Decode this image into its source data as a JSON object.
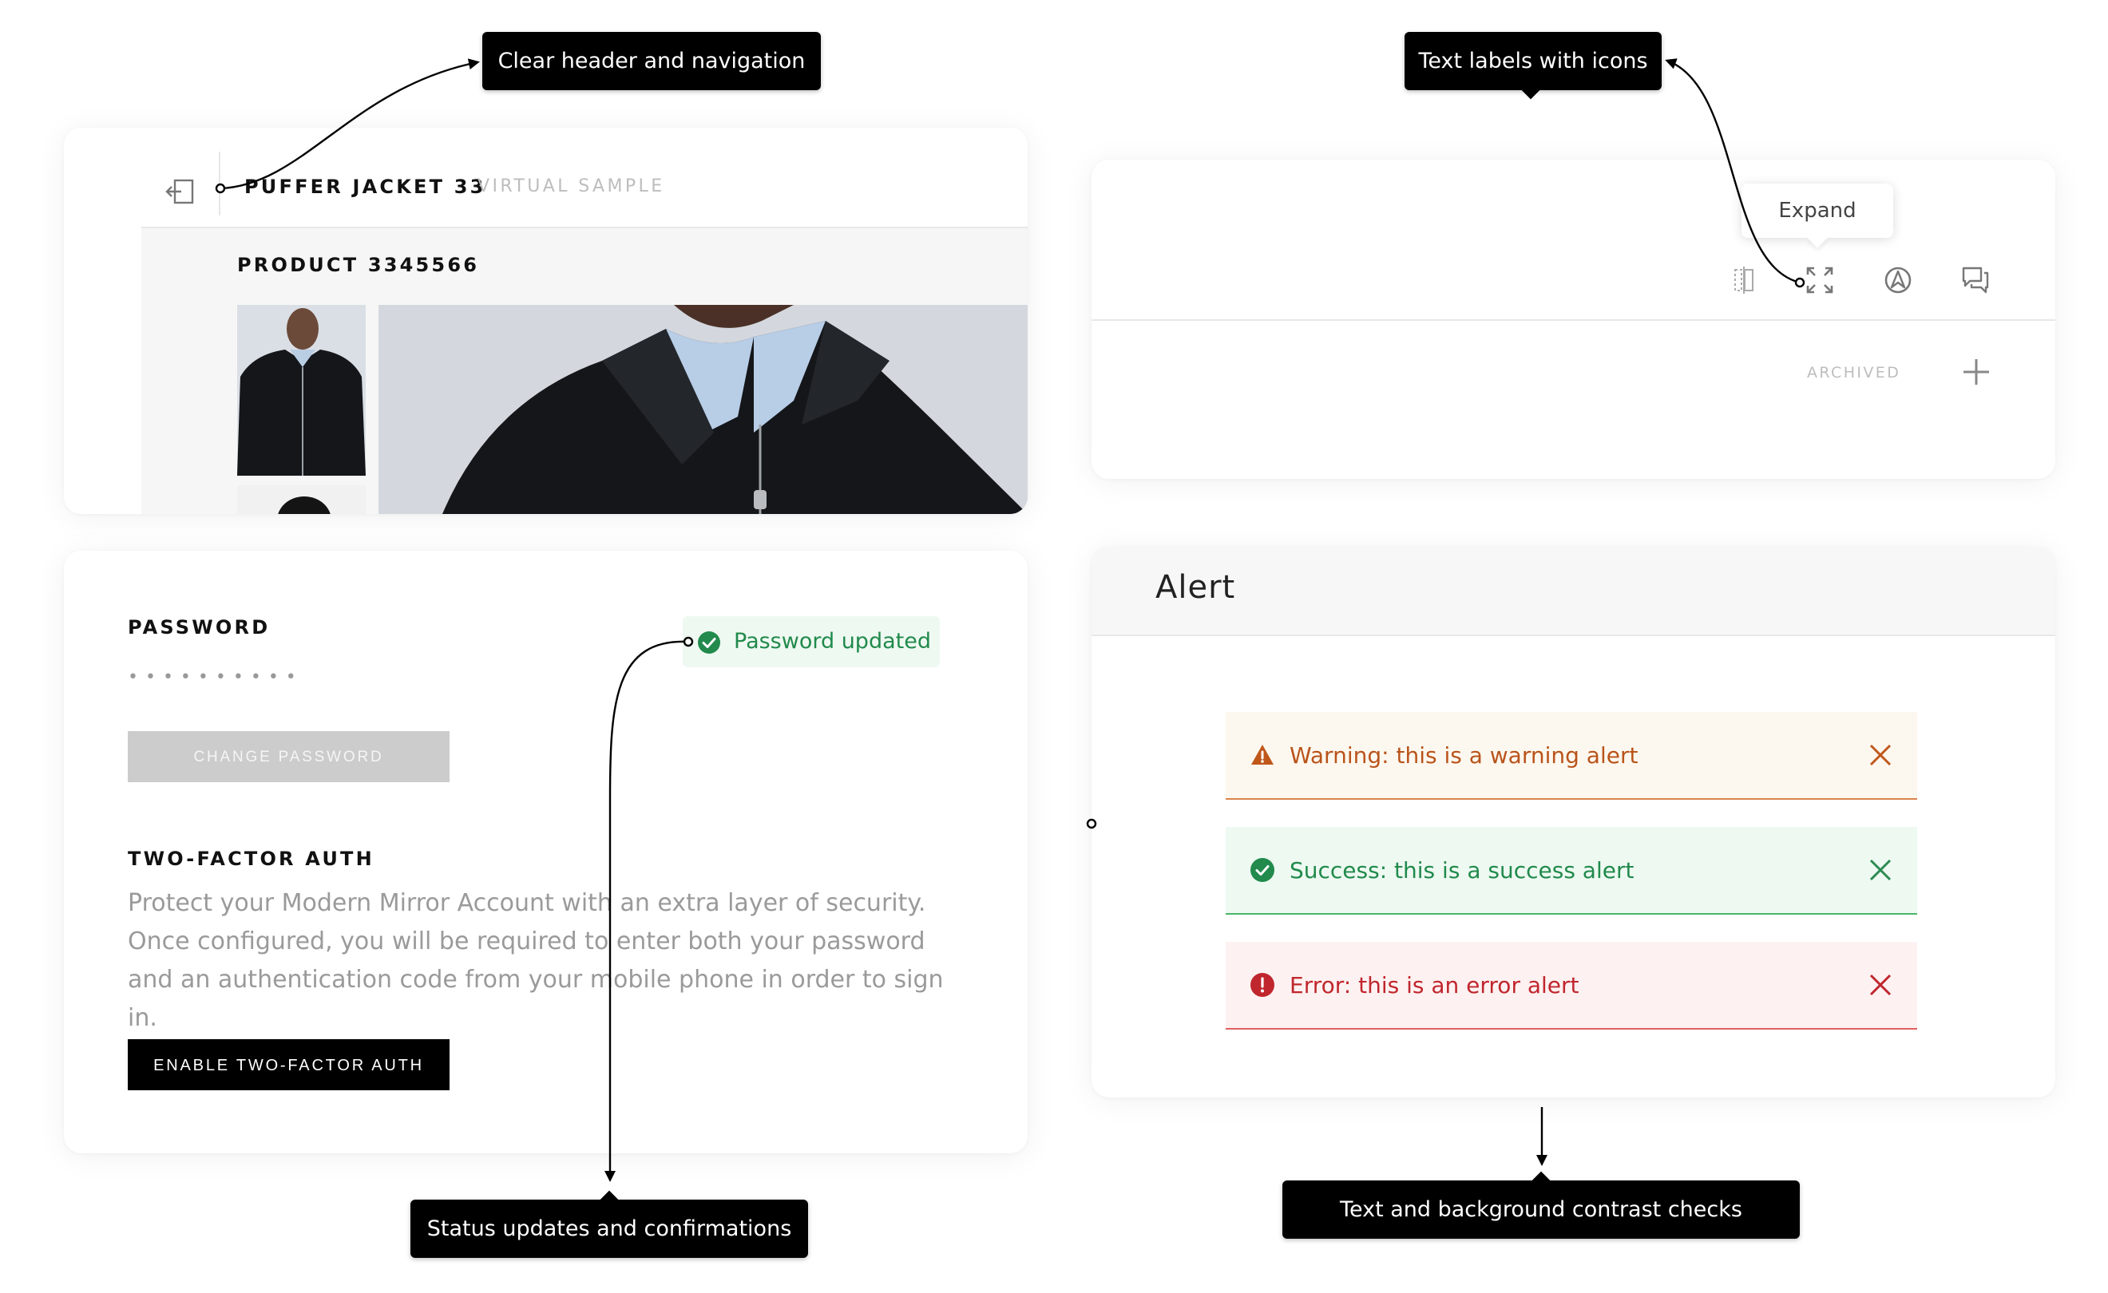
{
  "product_card": {
    "title": "PUFFER JACKET 33",
    "subtitle": "VIRTUAL SAMPLE",
    "product_code": "PRODUCT  3345566"
  },
  "toolbar_card": {
    "tooltip": "Expand",
    "archived_label": "ARCHIVED",
    "icons": [
      "split-view-icon",
      "expand-icon",
      "compass-icon",
      "comments-icon",
      "plus-icon"
    ]
  },
  "password_card": {
    "password_label": "PASSWORD",
    "password_mask": "••••••••••",
    "change_button": "CHANGE PASSWORD",
    "badge_text": "Password updated",
    "tfa_label": "TWO-FACTOR AUTH",
    "tfa_description": "Protect your Modern Mirror Account with an extra layer of security. Once configured, you will be required to enter both your password and an authentication code from your mobile phone in order to sign in.",
    "tfa_button": "ENABLE TWO-FACTOR AUTH"
  },
  "alert_card": {
    "title": "Alert",
    "alerts": [
      {
        "type": "warning",
        "label": "Warning:",
        "message": " this is a warning alert"
      },
      {
        "type": "success",
        "label": "Success:",
        "message": " this is a success alert"
      },
      {
        "type": "error",
        "label": "Error:",
        "message": " this is an error alert"
      }
    ]
  },
  "annotations": {
    "header": "Clear header and navigation",
    "icons": "Text labels with icons",
    "status": "Status updates and confirmations",
    "contrast": "Text and background  contrast checks"
  },
  "colors": {
    "warning": "#b9541b",
    "success": "#218a4c",
    "error": "#c0262d",
    "annotation_bg": "#000000"
  }
}
